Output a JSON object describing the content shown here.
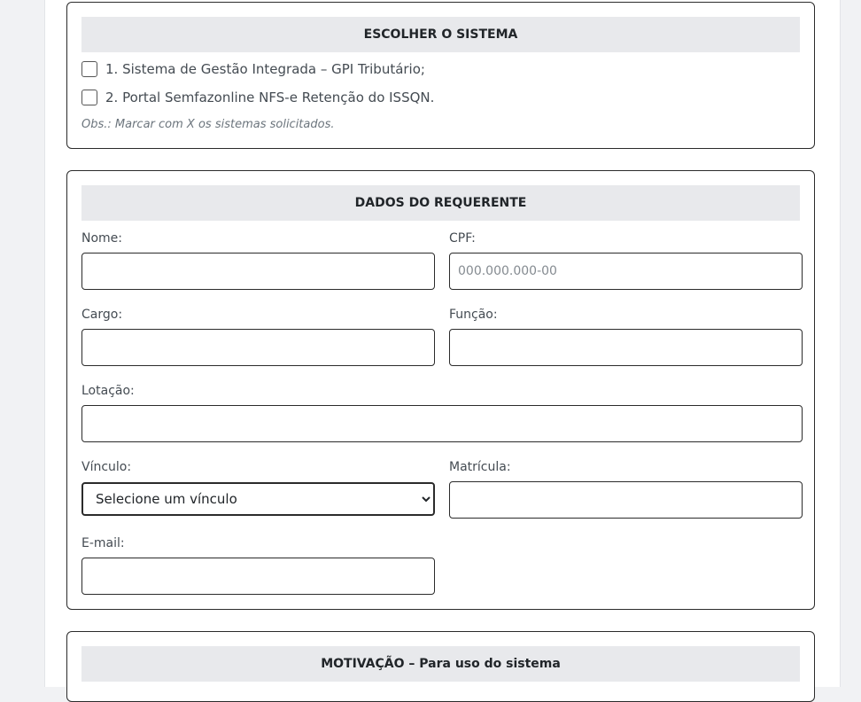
{
  "sistema": {
    "header": "ESCOLHER O SISTEMA",
    "options": [
      "1. Sistema de Gestão Integrada – GPI Tributário;",
      "2. Portal Semfazonline NFS-e Retenção do ISSQN."
    ],
    "obs": "Obs.: Marcar com X os sistemas solicitados."
  },
  "requerente": {
    "header": "DADOS DO REQUERENTE",
    "nome_label": "Nome:",
    "cpf_label": "CPF:",
    "cpf_placeholder": "000.000.000-00",
    "cargo_label": "Cargo:",
    "funcao_label": "Função:",
    "lotacao_label": "Lotação:",
    "vinculo_label": "Vínculo:",
    "vinculo_selected": "Selecione um vínculo",
    "matricula_label": "Matrícula:",
    "email_label": "E-mail:"
  },
  "motivacao": {
    "header": "MOTIVAÇÃO – Para uso do sistema"
  }
}
